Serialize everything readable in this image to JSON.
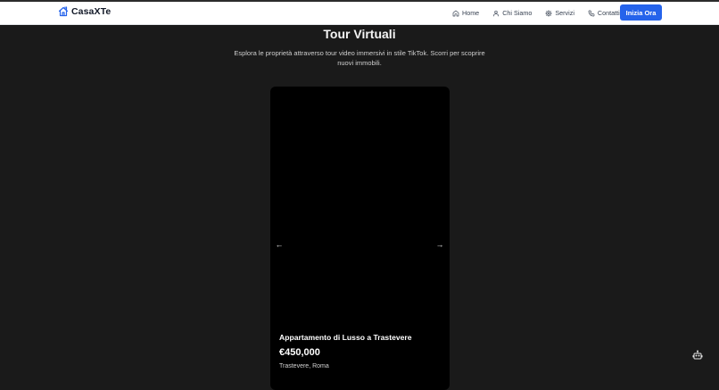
{
  "header": {
    "brand": "CasaXTe",
    "nav": [
      {
        "label": "Home",
        "icon": "home-icon"
      },
      {
        "label": "Chi Siamo",
        "icon": "user-icon"
      },
      {
        "label": "Servizi",
        "icon": "gear-icon"
      },
      {
        "label": "Contatti",
        "icon": "phone-icon"
      }
    ],
    "cta_label": "Inizia Ora",
    "accent_color": "#2563eb"
  },
  "main": {
    "title": "Tour Virtuali",
    "subtitle": "Esplora le proprietà attraverso tour video immersivi in stile TikTok. Scorri per scoprire nuovi immobili.",
    "prev_arrow": "←",
    "next_arrow": "→",
    "property": {
      "title": "Appartamento di Lusso a Trastevere",
      "price": "€450,000",
      "location": "Trastevere, Roma"
    }
  },
  "chatbot": {
    "icon": "robot-icon"
  }
}
